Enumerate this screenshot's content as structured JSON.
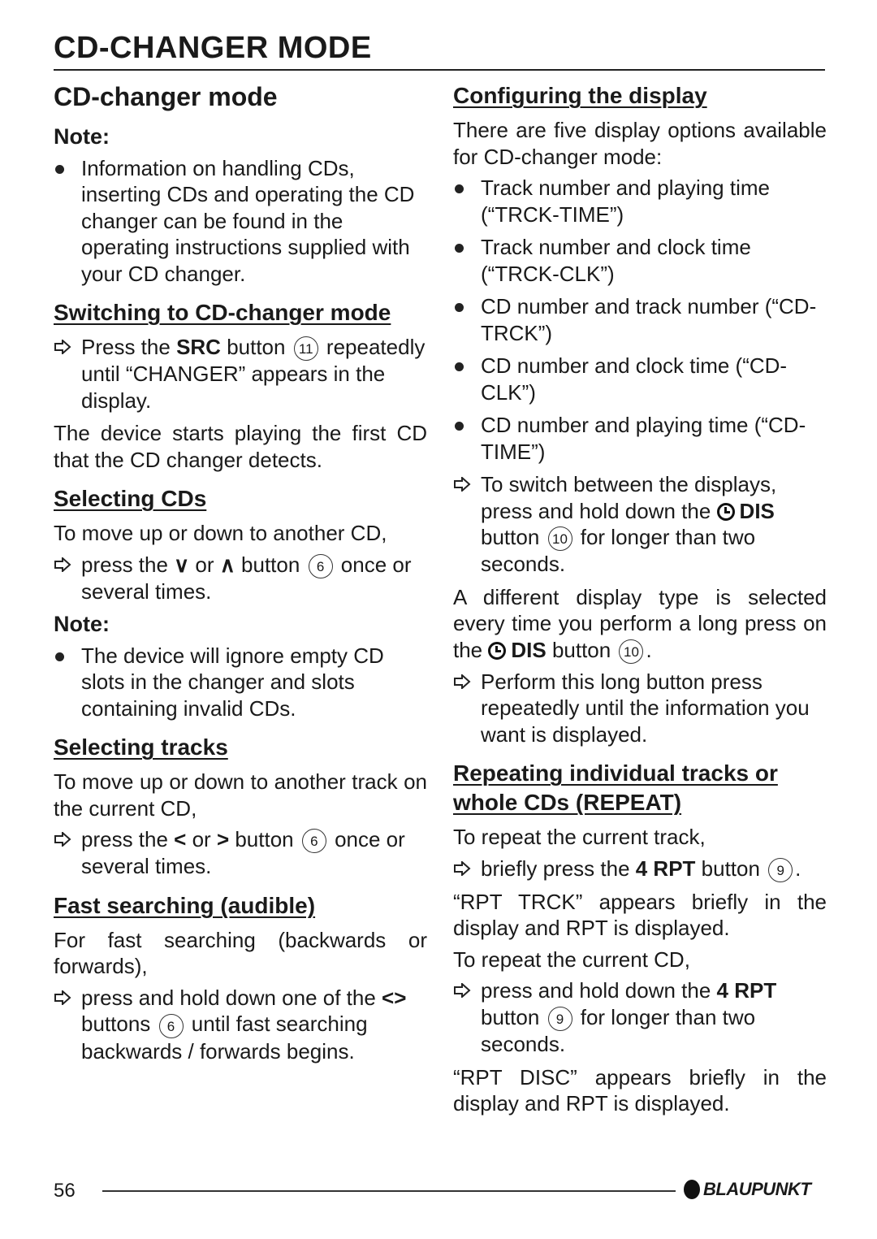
{
  "header": {
    "title": "CD-CHANGER MODE"
  },
  "left": {
    "section_title": "CD-changer mode",
    "note1": {
      "label": "Note:",
      "text": "Information on handling CDs, inserting CDs and operating the CD changer can be found in the operating instructions supplied with your CD changer."
    },
    "switching": {
      "heading": "Switching to CD-changer mode",
      "step_pre": "Press the ",
      "step_bold": "SRC",
      "step_mid": " button ",
      "step_num": "11",
      "step_post": " repeatedly until “CHANGER” appears in the display.",
      "para": "The device starts playing the first CD that the CD changer detects."
    },
    "selecting_cds": {
      "heading": "Selecting CDs",
      "para": "To move up or down to another CD,",
      "step_pre": "press the ",
      "glyph1": "∨",
      "step_or": " or ",
      "glyph2": "∧",
      "step_mid": " button ",
      "step_num": "6",
      "step_post": " once or several times."
    },
    "note2": {
      "label": "Note:",
      "text": "The device will ignore empty CD slots in the changer and slots containing invalid CDs."
    },
    "selecting_tracks": {
      "heading": "Selecting tracks",
      "para": "To move up or down to another track on the current CD,",
      "step_pre": "press the ",
      "glyph1": "<",
      "step_or": " or ",
      "glyph2": ">",
      "step_mid": " button ",
      "step_num": "6",
      "step_post": " once or several times."
    },
    "fast_search": {
      "heading": "Fast searching (audible)",
      "para": "For fast searching (backwards or forwards),",
      "step_pre": "press and hold down one of the ",
      "glyph": "<>",
      "step_mid": " buttons ",
      "step_num": "6",
      "step_post": " until fast searching backwards / forwards begins."
    }
  },
  "right": {
    "config": {
      "heading": "Configuring the display",
      "para": "There are five display options available for CD-changer mode:",
      "options": [
        "Track number and playing time (“TRCK-TIME”)",
        "Track number and clock time (“TRCK-CLK”)",
        "CD number and track number (“CD-TRCK”)",
        "CD number and clock time (“CD-CLK”)",
        "CD number and playing time (“CD-TIME”)"
      ],
      "step1_pre": "To switch between the displays, press and hold down the ",
      "step1_bold": "DIS",
      "step1_mid": " button ",
      "step1_num": "10",
      "step1_post": " for longer than two seconds.",
      "para2_pre": "A different display type is selected every time you perform a long press on the ",
      "para2_bold": "DIS",
      "para2_mid": " button ",
      "para2_num": "10",
      "para2_post": ".",
      "step2": "Perform this long button press repeatedly until the information you want is displayed."
    },
    "repeat": {
      "heading": "Repeating individual tracks or whole CDs (REPEAT)",
      "para1": "To repeat the current track,",
      "step1_pre": "briefly press the ",
      "step1_bold": "4 RPT",
      "step1_mid": " button ",
      "step1_num": "9",
      "step1_post": ".",
      "para2": "“RPT TRCK” appears briefly in the display and RPT is displayed.",
      "para3": "To repeat the current CD,",
      "step2_pre": "press and hold down the ",
      "step2_bold": "4 RPT",
      "step2_mid": " button ",
      "step2_num": "9",
      "step2_post": " for longer than two seconds.",
      "para4": "“RPT DISC” appears briefly in the display and RPT is displayed."
    }
  },
  "footer": {
    "page_number": "56",
    "brand": "BLAUPUNKT"
  }
}
